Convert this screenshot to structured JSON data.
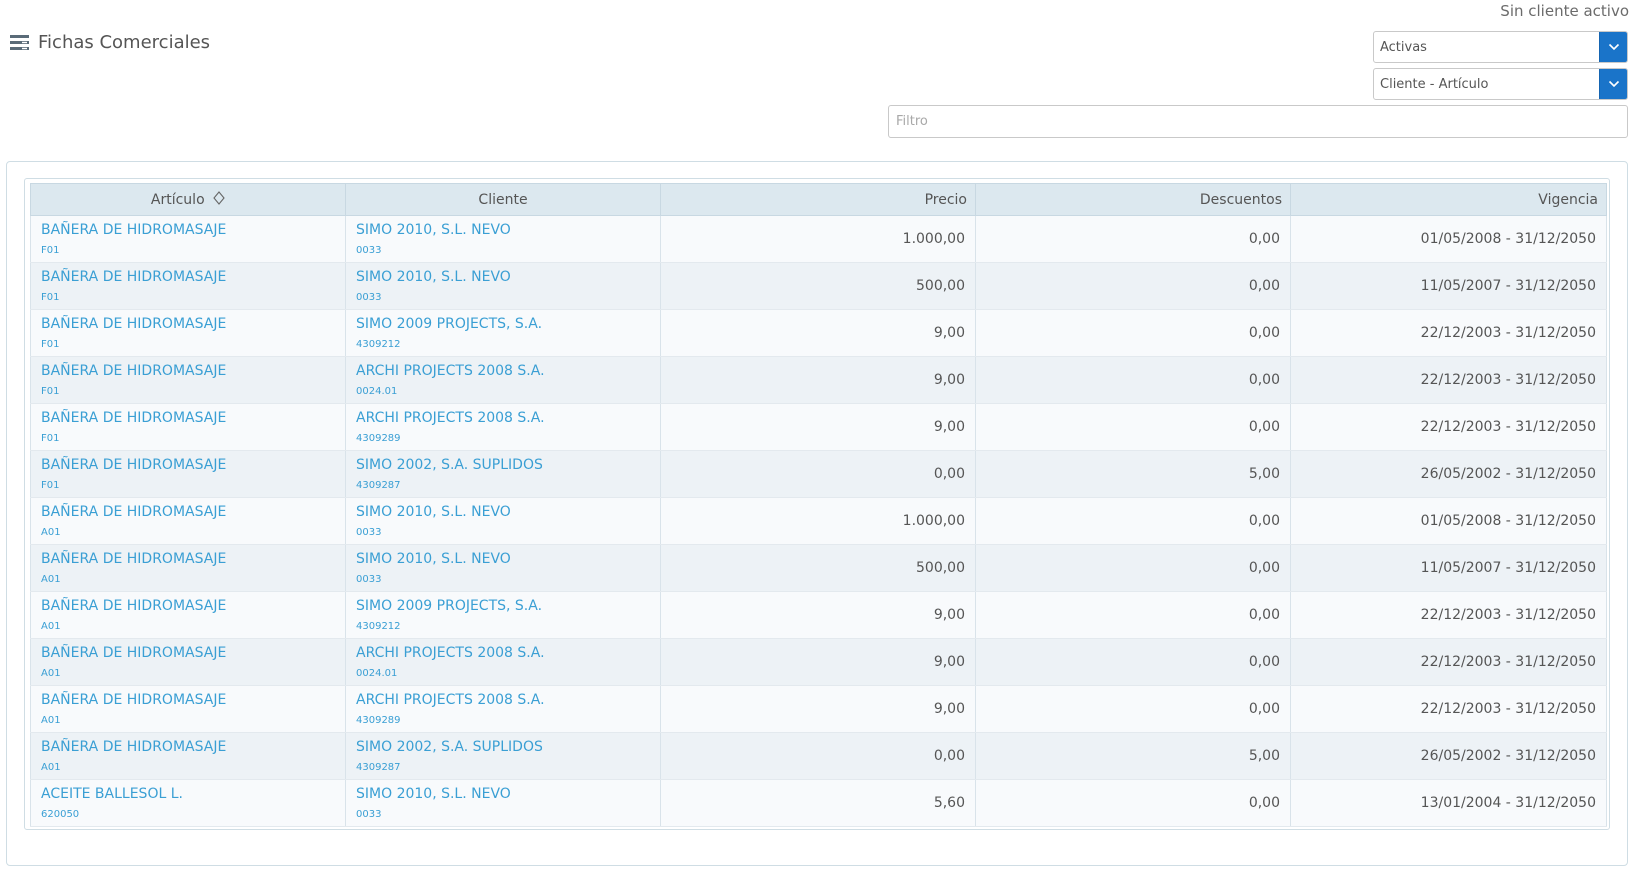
{
  "status": "Sin cliente activo",
  "header": {
    "icon": "list-icon",
    "title": "Fichas Comerciales"
  },
  "filters": {
    "state": {
      "value": "Activas",
      "icon": "chevron-down-icon"
    },
    "grouping": {
      "value": "Cliente - Artículo",
      "icon": "chevron-down-icon"
    },
    "search": {
      "placeholder": "Filtro",
      "value": ""
    }
  },
  "colors": {
    "accent": "#1a74c9",
    "link": "#3a9fd4",
    "header_bg": "#dce8ef"
  },
  "table": {
    "columns": [
      {
        "label": "Artículo",
        "sort_icon": "sort-icon"
      },
      {
        "label": "Cliente"
      },
      {
        "label": "Precio"
      },
      {
        "label": "Descuentos"
      },
      {
        "label": "Vigencia"
      }
    ],
    "rows": [
      {
        "articulo": "BAÑERA DE HIDROMASAJE",
        "articulo_code": "F01",
        "cliente": "SIMO 2010, S.L. NEVO",
        "cliente_code": "0033",
        "precio": "1.000,00",
        "descuentos": "0,00",
        "vigencia": "01/05/2008 - 31/12/2050"
      },
      {
        "articulo": "BAÑERA DE HIDROMASAJE",
        "articulo_code": "F01",
        "cliente": "SIMO 2010, S.L. NEVO",
        "cliente_code": "0033",
        "precio": "500,00",
        "descuentos": "0,00",
        "vigencia": "11/05/2007 - 31/12/2050"
      },
      {
        "articulo": "BAÑERA DE HIDROMASAJE",
        "articulo_code": "F01",
        "cliente": "SIMO 2009 PROJECTS, S.A.",
        "cliente_code": "4309212",
        "precio": "9,00",
        "descuentos": "0,00",
        "vigencia": "22/12/2003 - 31/12/2050"
      },
      {
        "articulo": "BAÑERA DE HIDROMASAJE",
        "articulo_code": "F01",
        "cliente": "ARCHI PROJECTS 2008 S.A.",
        "cliente_code": "0024.01",
        "precio": "9,00",
        "descuentos": "0,00",
        "vigencia": "22/12/2003 - 31/12/2050"
      },
      {
        "articulo": "BAÑERA DE HIDROMASAJE",
        "articulo_code": "F01",
        "cliente": "ARCHI PROJECTS 2008 S.A.",
        "cliente_code": "4309289",
        "precio": "9,00",
        "descuentos": "0,00",
        "vigencia": "22/12/2003 - 31/12/2050"
      },
      {
        "articulo": "BAÑERA DE HIDROMASAJE",
        "articulo_code": "F01",
        "cliente": "SIMO 2002, S.A. SUPLIDOS",
        "cliente_code": "4309287",
        "precio": "0,00",
        "descuentos": "5,00",
        "vigencia": "26/05/2002 - 31/12/2050"
      },
      {
        "articulo": "BAÑERA DE HIDROMASAJE",
        "articulo_code": "A01",
        "cliente": "SIMO 2010, S.L. NEVO",
        "cliente_code": "0033",
        "precio": "1.000,00",
        "descuentos": "0,00",
        "vigencia": "01/05/2008 - 31/12/2050"
      },
      {
        "articulo": "BAÑERA DE HIDROMASAJE",
        "articulo_code": "A01",
        "cliente": "SIMO 2010, S.L. NEVO",
        "cliente_code": "0033",
        "precio": "500,00",
        "descuentos": "0,00",
        "vigencia": "11/05/2007 - 31/12/2050"
      },
      {
        "articulo": "BAÑERA DE HIDROMASAJE",
        "articulo_code": "A01",
        "cliente": "SIMO 2009 PROJECTS, S.A.",
        "cliente_code": "4309212",
        "precio": "9,00",
        "descuentos": "0,00",
        "vigencia": "22/12/2003 - 31/12/2050"
      },
      {
        "articulo": "BAÑERA DE HIDROMASAJE",
        "articulo_code": "A01",
        "cliente": "ARCHI PROJECTS 2008 S.A.",
        "cliente_code": "0024.01",
        "precio": "9,00",
        "descuentos": "0,00",
        "vigencia": "22/12/2003 - 31/12/2050"
      },
      {
        "articulo": "BAÑERA DE HIDROMASAJE",
        "articulo_code": "A01",
        "cliente": "ARCHI PROJECTS 2008 S.A.",
        "cliente_code": "4309289",
        "precio": "9,00",
        "descuentos": "0,00",
        "vigencia": "22/12/2003 - 31/12/2050"
      },
      {
        "articulo": "BAÑERA DE HIDROMASAJE",
        "articulo_code": "A01",
        "cliente": "SIMO 2002, S.A. SUPLIDOS",
        "cliente_code": "4309287",
        "precio": "0,00",
        "descuentos": "5,00",
        "vigencia": "26/05/2002 - 31/12/2050"
      },
      {
        "articulo": "ACEITE BALLESOL L.",
        "articulo_code": "620050",
        "cliente": "SIMO 2010, S.L. NEVO",
        "cliente_code": "0033",
        "precio": "5,60",
        "descuentos": "0,00",
        "vigencia": "13/01/2004 - 31/12/2050"
      }
    ]
  }
}
